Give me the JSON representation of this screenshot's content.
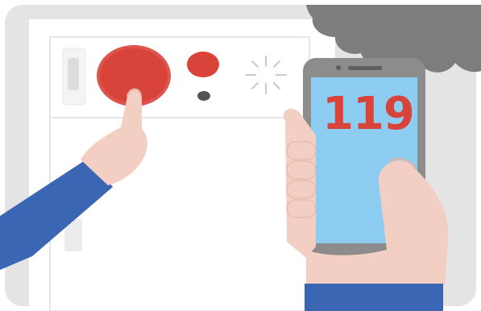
{
  "phone": {
    "screen_number": "119"
  },
  "colors": {
    "panel_border": "#e2e2e2",
    "alarm_button": "#d9443a",
    "phone_screen": "#8ecdf2",
    "sleeve": "#3b66b3",
    "skin": "#f2cfc2",
    "smoke": "#7d7d7d"
  },
  "icons": {
    "alarm_push_button": "red-circle-button",
    "indicator_lamp": "small-red-circle",
    "sound_vent": "sparkle-burst",
    "smoke_cloud": "cloud"
  }
}
